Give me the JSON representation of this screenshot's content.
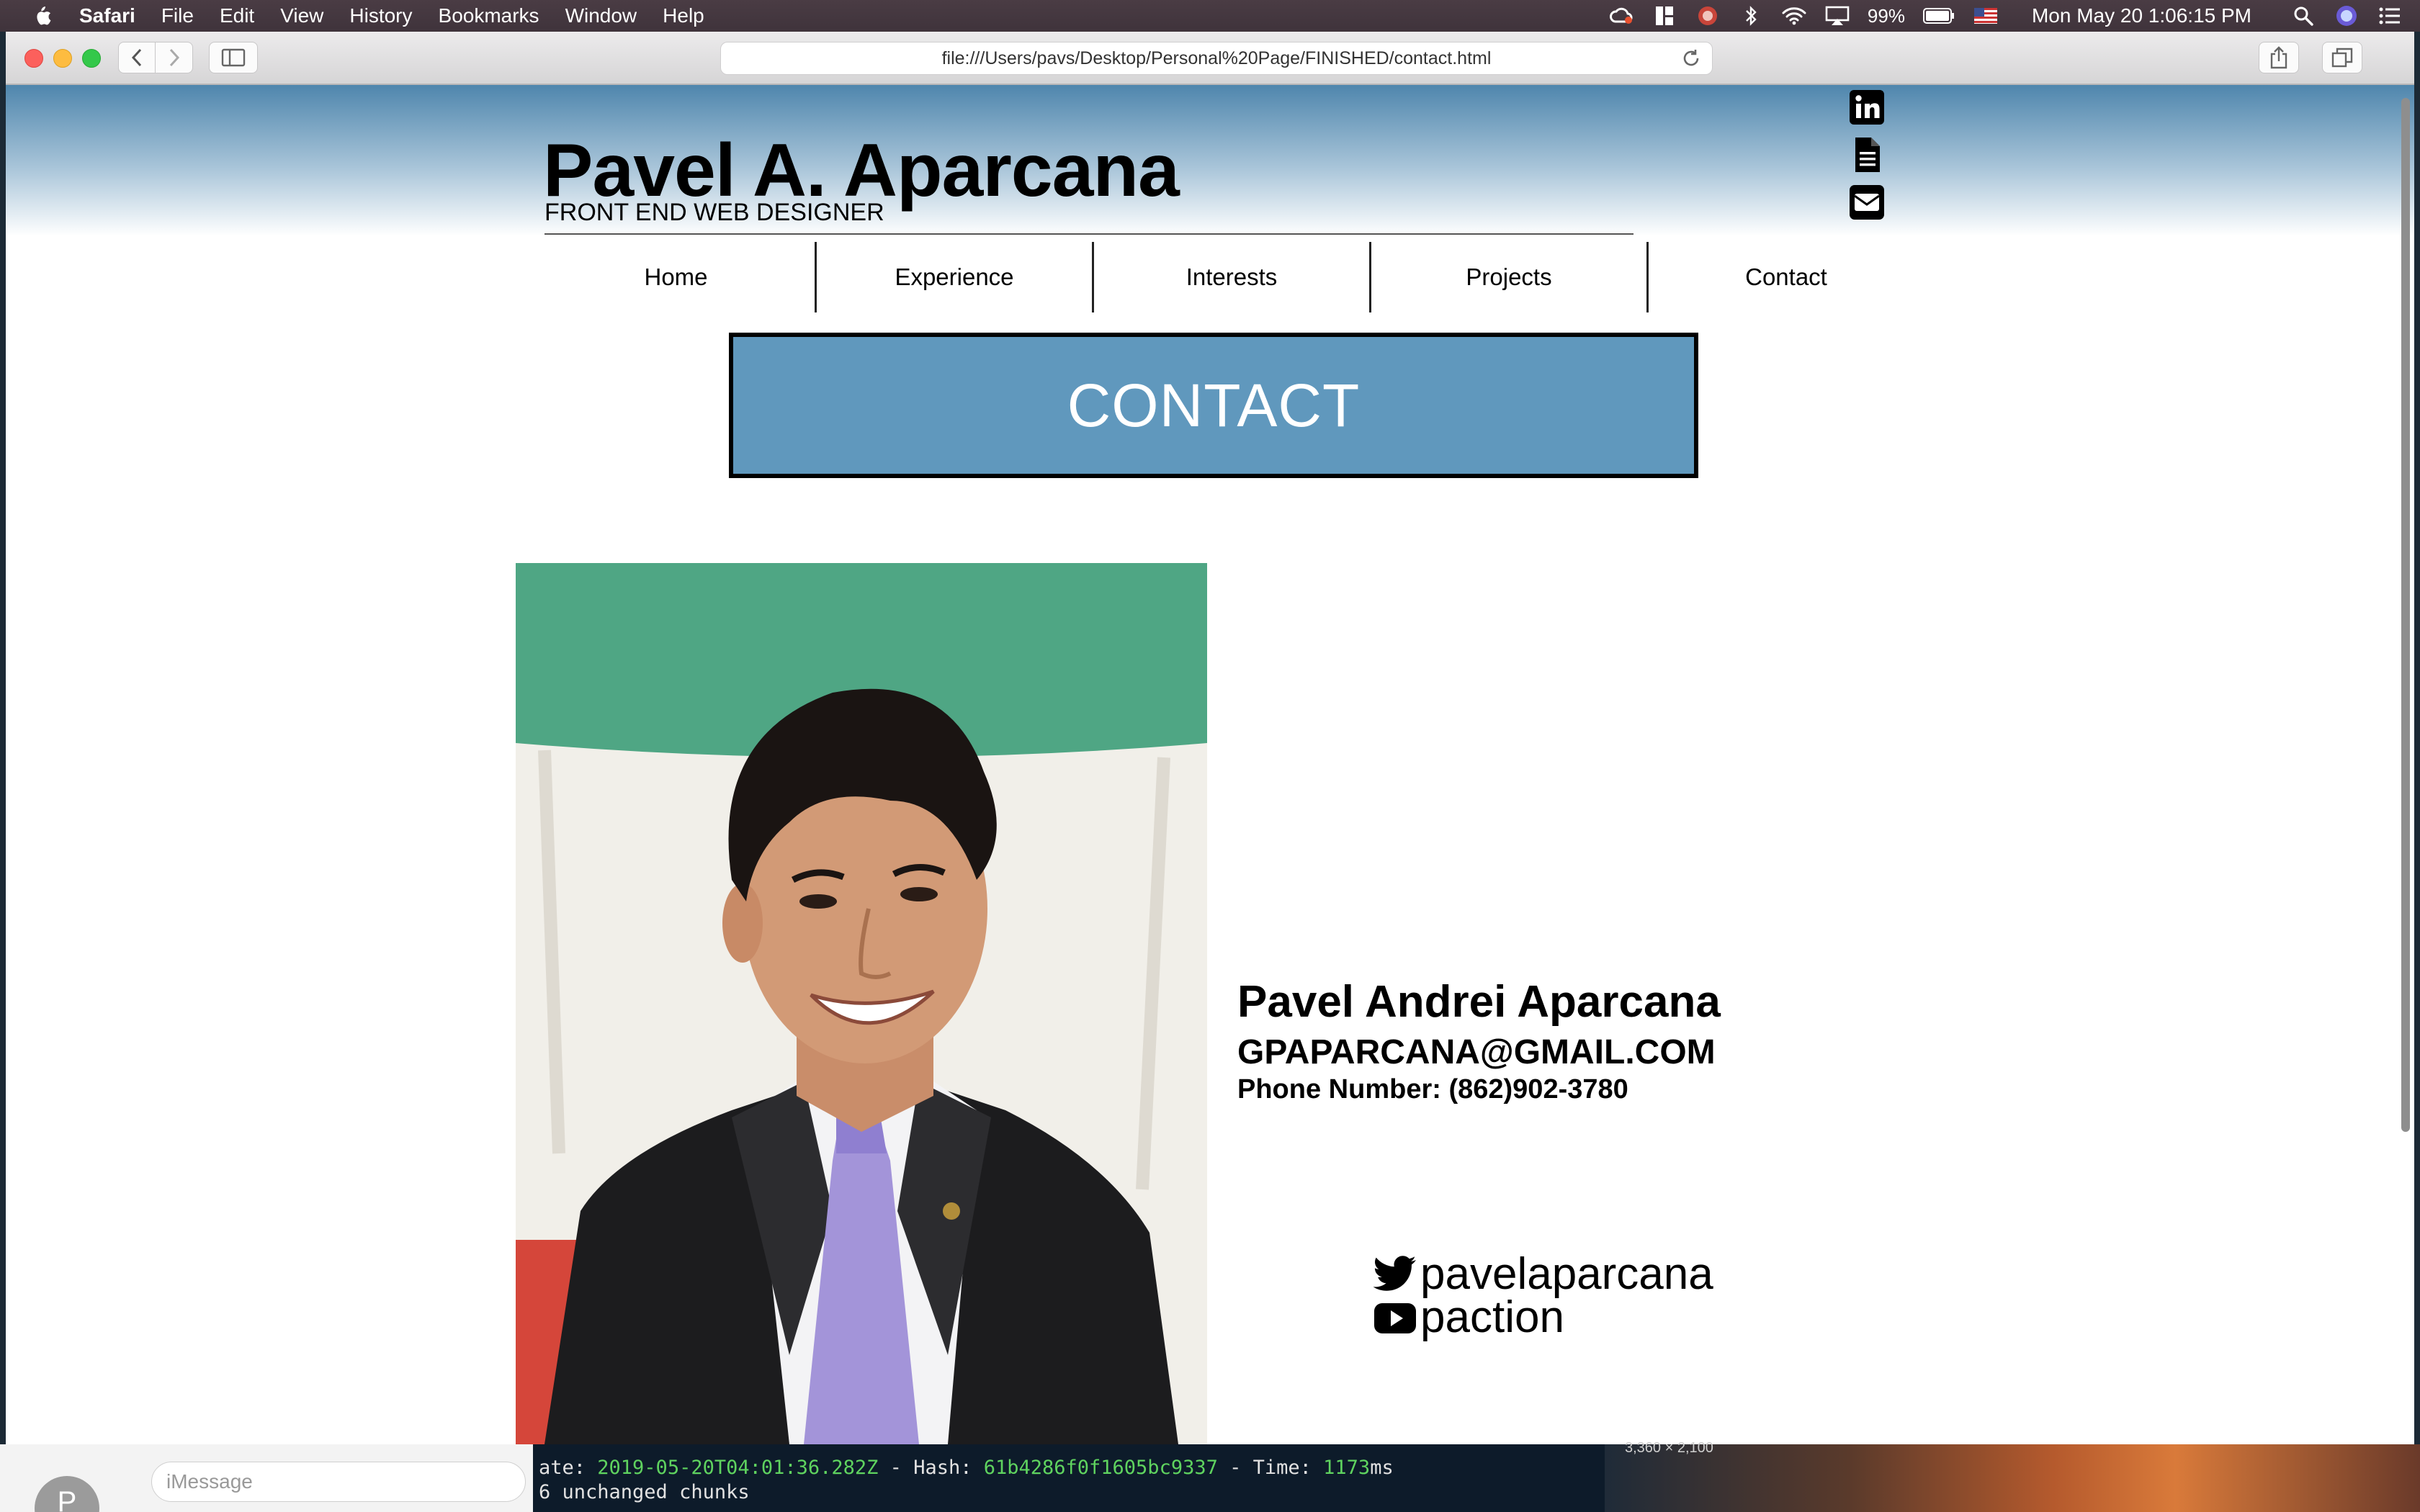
{
  "menubar": {
    "app": "Safari",
    "items": [
      "File",
      "Edit",
      "View",
      "History",
      "Bookmarks",
      "Window",
      "Help"
    ],
    "battery": "99%",
    "datetime": "Mon May 20  1:06:15 PM"
  },
  "browser": {
    "url": "file:///Users/pavs/Desktop/Personal%20Page/FINISHED/contact.html"
  },
  "site": {
    "title": "Pavel A. Aparcana",
    "subtitle": "FRONT END WEB DESIGNER",
    "social_icons": [
      "linkedin-icon",
      "document-icon",
      "mail-icon"
    ],
    "nav": [
      "Home",
      "Experience",
      "Interests",
      "Projects",
      "Contact"
    ],
    "banner": "CONTACT",
    "contact": {
      "name": "Pavel Andrei Aparcana",
      "email": "GPAPARCANA@GMAIL.COM",
      "phone": "Phone Number: (862)902-3780"
    },
    "twitter_handle": "pavelaparcana",
    "youtube_handle": "paction"
  },
  "background": {
    "imessage_placeholder": "iMessage",
    "avatar_initial": "P",
    "terminal_line1_prefix": "ate: ",
    "terminal_date": "2019-05-20T04:01:36.282Z",
    "terminal_hash_label": " - Hash: ",
    "terminal_hash": "61b4286f0f1605bc9337",
    "terminal_time_label": " - Time: ",
    "terminal_time": "1173",
    "terminal_time_unit": "ms",
    "terminal_line2": "6 unchanged chunks",
    "desktop_label": "3,360 × 2,100"
  },
  "colors": {
    "banner": "#6098bd",
    "header_top": "#4f86ad",
    "terminal_green": "#5fd35f",
    "terminal_blue": "#6cb5ff"
  }
}
